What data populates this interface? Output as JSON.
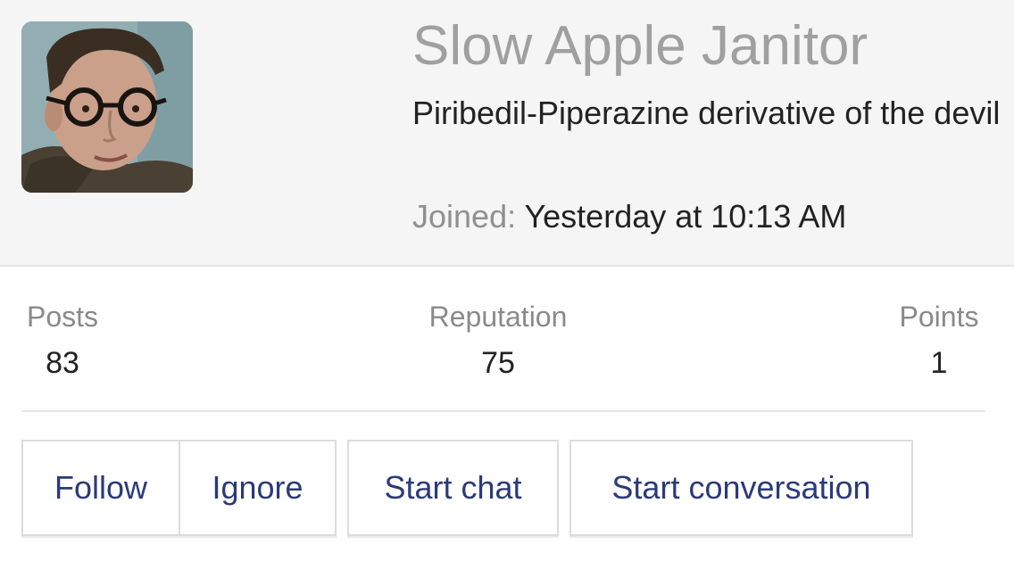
{
  "profile": {
    "username": "Slow Apple Janitor",
    "user_title": "Piribedil-Piperazine derivative of the devil",
    "joined_label": "Joined:",
    "joined_value": "Yesterday at 10:13 AM",
    "avatar": "user-avatar-photo"
  },
  "stats": {
    "posts": {
      "label": "Posts",
      "value": "83"
    },
    "reputation": {
      "label": "Reputation",
      "value": "75"
    },
    "points": {
      "label": "Points",
      "value": "1"
    }
  },
  "actions": {
    "follow": "Follow",
    "ignore": "Ignore",
    "start_chat": "Start chat",
    "start_conversation": "Start conversation"
  },
  "colors": {
    "header_bg": "#f5f5f5",
    "username": "#a0a0a0",
    "button_text": "#2b3a78",
    "border": "#dcdcdc"
  }
}
